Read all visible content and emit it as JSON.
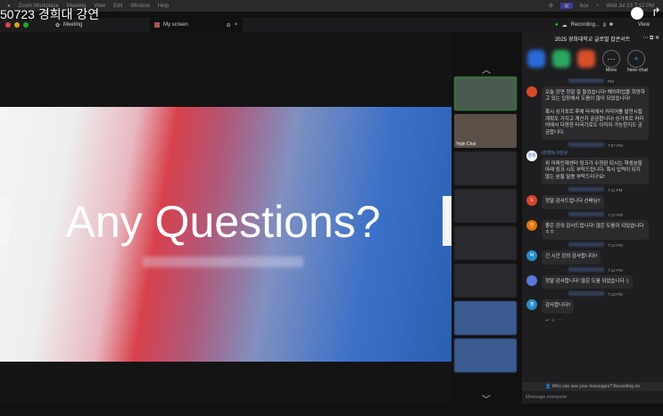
{
  "menubar": {
    "app": "Zoom Workplace",
    "items": [
      "Meeting",
      "View",
      "Edit",
      "Window",
      "Help"
    ],
    "status_icons": [
      "settings-icon",
      "screen-icon",
      "box-icon",
      "t-icon",
      "b-icon",
      "copy-icon",
      "headphones-icon",
      "play-icon",
      "moon-icon",
      "a-icon",
      "battery-icon",
      "wifi-icon",
      "search-icon",
      "user-icon"
    ],
    "box": "box",
    "datetime": "Wed Jul 23 7:12 PM"
  },
  "overlay_title": "50723 경희대 강연",
  "window": {
    "meeting_tab": "Meeting",
    "screen_tab": "My screen",
    "recording": "Recording...",
    "view": "View"
  },
  "slide": {
    "title": "Any Questions?"
  },
  "thumbs": {
    "presenter_name": "Yejin Choi"
  },
  "chat": {
    "title": "2025 경희대학교 글로벌 잡콘서트",
    "more_label": "More",
    "new_chat_label": "New chat",
    "messages": [
      {
        "time": "PM",
        "initial": "",
        "color": "#d84a2a",
        "text": "오늘 강연 정말 잘 들었습니다! 해외취업을 희망하고 있는 입장에서 도움이 많이 되었습니다!\n\n혹시 싱가포르 후에 타국에서 커리어를 발전시킬 계획도 가지고 계신지 궁금합니다! 싱가포르 커리어에서 다양한 타국가로도 이직이 가능한지도 궁금합니다."
      },
      {
        "time": "7:07 PM",
        "sender": "(진행자) 이민규",
        "initial": "경희",
        "color": "#ffffff",
        "text": "위 미래인재센터 링크가 수정된 되시는 학생분들 아래 링크 시도 부탁드립니다. 혹시 입력이 되지 않는 분들 말씀 부탁드리구요!"
      },
      {
        "time": "7:11 PM",
        "initial": "노",
        "color": "#d8432e",
        "text": "정말 감사드립니다 선배님!!"
      },
      {
        "time": "7:12 PM",
        "initial": "안",
        "color": "#e0730a",
        "text": "좋은 강의 감사드립니다! 많은 도움이 되었습니다 ㅎㅎ"
      },
      {
        "time": "7:12 PM",
        "initial": "박",
        "color": "#2a8ac8",
        "text": "긴 시간 강의 감사합니다!!"
      },
      {
        "time": "7:12 PM",
        "initial": "",
        "color": "#5a78d8",
        "text": "정말 감사합니다! 많은 도움 되었습니다 :)"
      },
      {
        "time": "7:13 PM",
        "initial": "정",
        "color": "#2a8ac8",
        "text": "감사합니다!!"
      }
    ],
    "notice": "Who can see your messages? Recording on",
    "input_placeholder": "Message everyone"
  }
}
